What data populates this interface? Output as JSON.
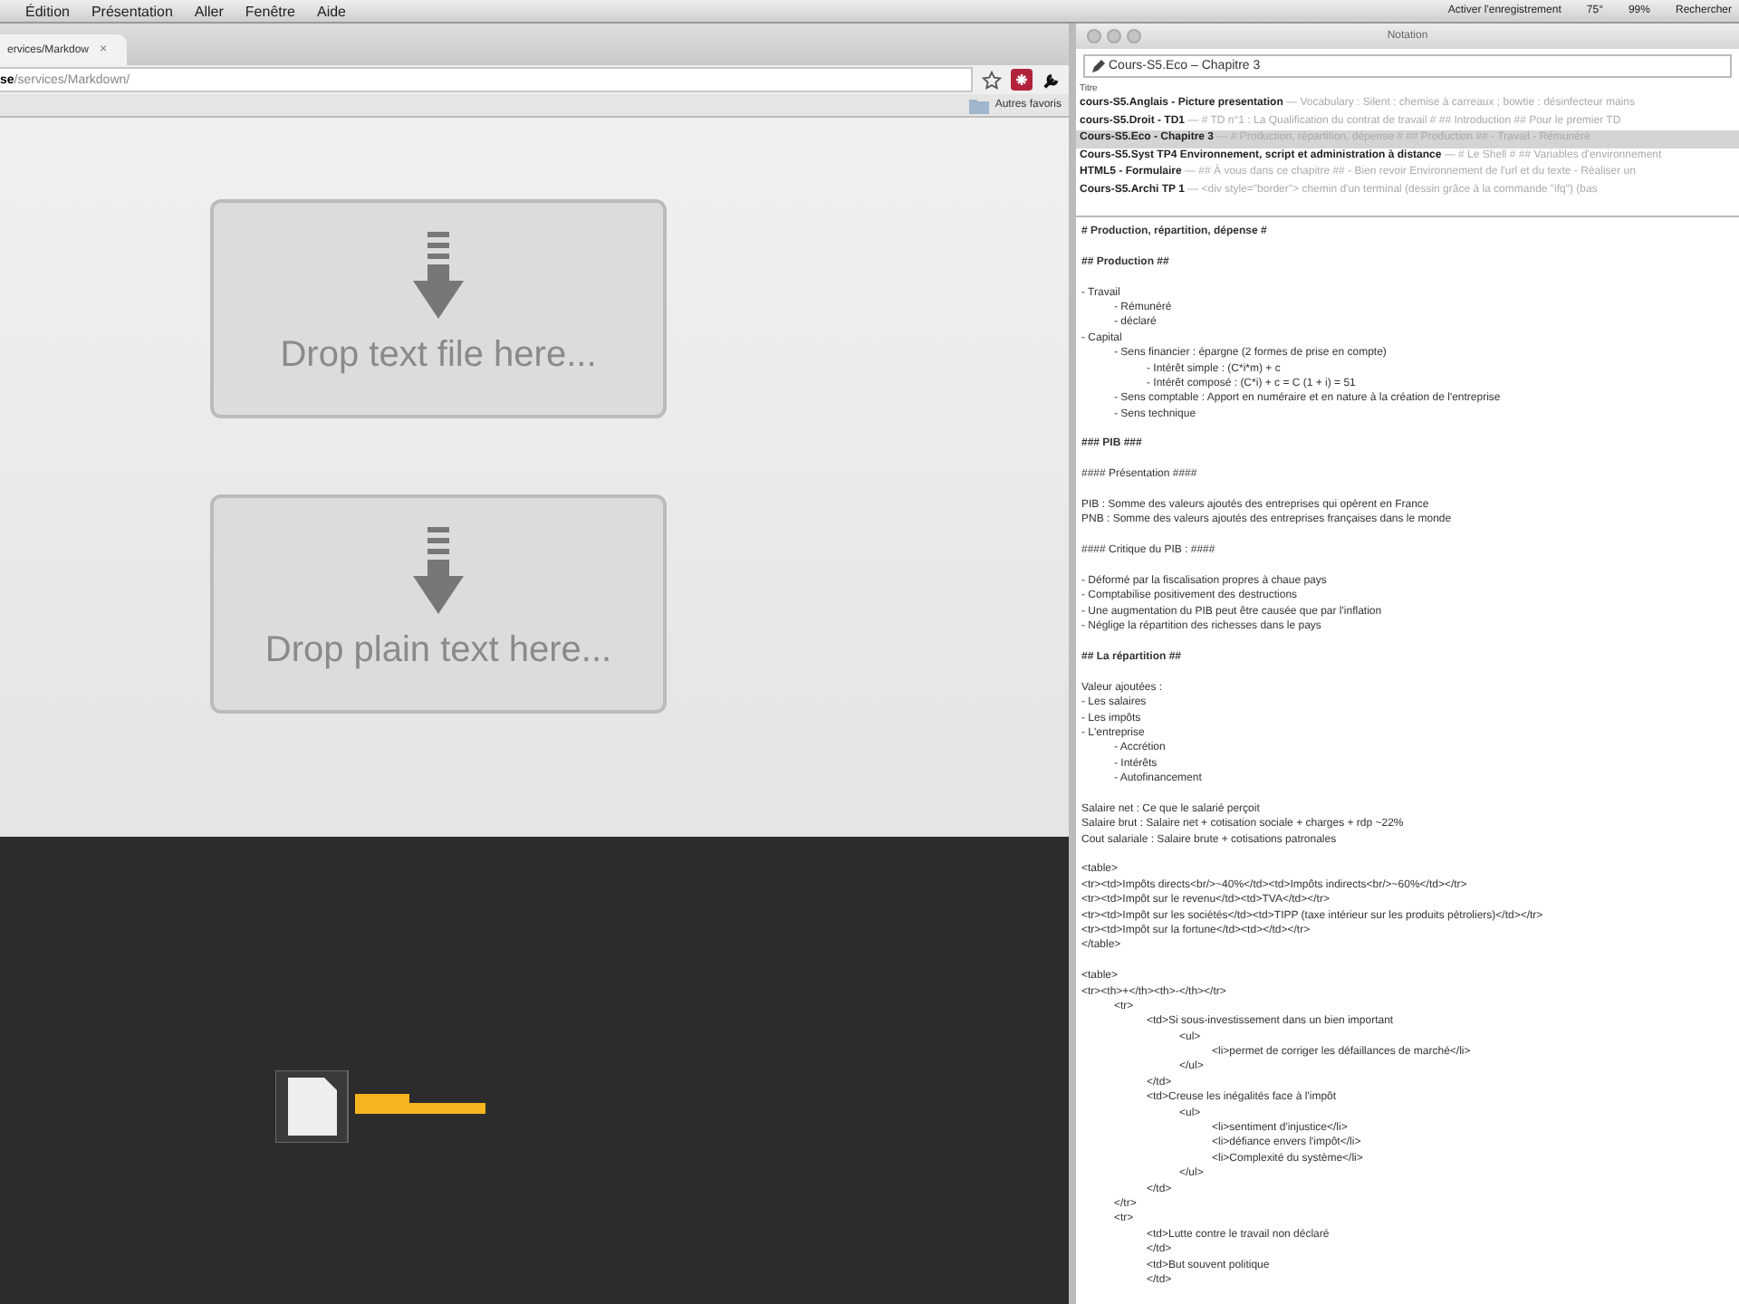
{
  "menu_bar": {
    "items": [
      "Édition",
      "Présentation",
      "Aller",
      "Fenêtre",
      "Aide"
    ],
    "status": [
      "Activer l'enregistrement",
      "75°",
      "99%",
      "Rechercher"
    ]
  },
  "browser": {
    "tab": {
      "label": "ervices/Markdow",
      "close": "×"
    },
    "url": {
      "host": "se",
      "path": "/services/Markdown/"
    },
    "bookmarks": [
      "Autres favoris"
    ],
    "drop_zones": [
      {
        "label": "Drop text file here..."
      },
      {
        "label": "Drop plain text here..."
      }
    ]
  },
  "notation": {
    "title": "Notation",
    "note_title": "Cours-S5.Eco – Chapitre 3",
    "list_header": "Titre",
    "notes": [
      {
        "title": "cours-S5.Anglais - Picture presentation",
        "preview": "— Vocabulary : Silent : chemise à carreaux ; bowtie : désinfecteur mains",
        "selected": false
      },
      {
        "title": "cours-S5.Droit - TD1",
        "preview": "— # TD n°1 : La Qualification du contrat de travail # ## Introduction ## Pour le premier TD",
        "selected": false
      },
      {
        "title": "Cours-S5.Eco - Chapitre 3",
        "preview": "— # Production, répartition, dépense # ## Production ## - Travail - Rémunéré",
        "selected": true
      },
      {
        "title": "Cours-S5.Syst TP4 Environnement, script et administration à distance",
        "preview": "— # Le Shell # ## Variables d'environnement",
        "selected": false
      },
      {
        "title": "HTML5 - Formulaire",
        "preview": "— ## À vous dans ce chapitre ## - Bien revoir Environnement de l'url et du texte - Réaliser un",
        "selected": false
      },
      {
        "title": "Cours-S5.Archi TP 1",
        "preview": "— <div style=\"border\"> chemin d'un terminal (dessin grâce à la commande \"ifq\") (bas",
        "selected": false
      }
    ],
    "lines": [
      {
        "kind": "heading",
        "text": "# Production, répartition, dépense #"
      },
      {
        "kind": "blank"
      },
      {
        "kind": "heading",
        "text": "## Production ##"
      },
      {
        "kind": "blank"
      },
      {
        "kind": "line",
        "text": "- Travail",
        "children": [
          {
            "kind": "line",
            "text": "- Rémunéré"
          },
          {
            "kind": "line",
            "text": "- déclaré"
          }
        ]
      },
      {
        "kind": "line",
        "text": "- Capital",
        "children": [
          {
            "kind": "line",
            "text": "- Sens financier : épargne (2 formes de prise en compte)",
            "children": [
              {
                "kind": "line",
                "text": "- Intérêt simple : (C*i*m) + c"
              },
              {
                "kind": "line",
                "text": "- Intérêt composé : (C*i) + c = C (1 + i) = 51"
              }
            ]
          },
          {
            "kind": "line",
            "text": "- Sens comptable : Apport en numéraire et en nature à la création de l'entreprise"
          },
          {
            "kind": "line",
            "text": "- Sens technique"
          }
        ]
      },
      {
        "kind": "blank"
      },
      {
        "kind": "heading",
        "text": "### PIB ###"
      },
      {
        "kind": "blank"
      },
      {
        "kind": "line",
        "text": "#### Présentation ####"
      },
      {
        "kind": "blank"
      },
      {
        "kind": "line",
        "text": "PIB : Somme des valeurs ajoutés des entreprises qui opèrent en France"
      },
      {
        "kind": "line",
        "text": "PNB : Somme des valeurs ajoutés des entreprises françaises dans le monde"
      },
      {
        "kind": "blank"
      },
      {
        "kind": "line",
        "text": "#### Critique du PIB : ####"
      },
      {
        "kind": "blank"
      },
      {
        "kind": "line",
        "text": "- Déformé par la fiscalisation propres à chaue pays"
      },
      {
        "kind": "line",
        "text": "- Comptabilise positivement des destructions"
      },
      {
        "kind": "line",
        "text": "- Une augmentation du PIB peut être causée que par l'inflation"
      },
      {
        "kind": "line",
        "text": "- Néglige la répartition des richesses dans le pays"
      },
      {
        "kind": "blank"
      },
      {
        "kind": "heading",
        "text": "## La répartition ##"
      },
      {
        "kind": "blank"
      },
      {
        "kind": "line",
        "text": "Valeur ajoutées :"
      },
      {
        "kind": "line",
        "text": "- Les salaires"
      },
      {
        "kind": "line",
        "text": "- Les impôts"
      },
      {
        "kind": "line",
        "text": "- L'entreprise",
        "children": [
          {
            "kind": "line",
            "text": "- Accrétion"
          },
          {
            "kind": "line",
            "text": "- Intérêts"
          },
          {
            "kind": "line",
            "text": "- Autofinancement"
          }
        ]
      },
      {
        "kind": "blank"
      },
      {
        "kind": "line",
        "text": "Salaire net : Ce que le salarié perçoit"
      },
      {
        "kind": "line",
        "text": "Salaire brut : Salaire net + cotisation sociale + charges + rdp ~22%"
      },
      {
        "kind": "line",
        "text": "Cout salariale : Salaire brute + cotisations patronales"
      },
      {
        "kind": "blank"
      },
      {
        "kind": "line",
        "text": "<table>"
      },
      {
        "kind": "line",
        "text": "<tr><td>Impôts directs<br/>~40%</td><td>Impôts indirects<br/>~60%</td></tr>"
      },
      {
        "kind": "line",
        "text": "<tr><td>Impôt sur le revenu</td><td>TVA</td></tr>"
      },
      {
        "kind": "line",
        "text": "<tr><td>Impôt sur les sociétés</td><td>TIPP (taxe intérieur sur les produits pétroliers)</td></tr>"
      },
      {
        "kind": "line",
        "text": "<tr><td>Impôt sur la fortune</td><td></td></tr>"
      },
      {
        "kind": "line",
        "text": "</table>"
      },
      {
        "kind": "blank"
      },
      {
        "kind": "line",
        "text": "<table>"
      },
      {
        "kind": "line",
        "text": "<tr><th>+</th><th>-</th></tr>",
        "children": [
          {
            "kind": "line",
            "text": "<tr>",
            "children": [
              {
                "kind": "line",
                "text": "<td>Si sous-investissement dans un bien important",
                "children": [
                  {
                    "kind": "line",
                    "text": "<ul>",
                    "children": [
                      {
                        "kind": "line",
                        "text": "<li>permet de corriger les défaillances de marché</li>"
                      }
                    ]
                  },
                  {
                    "kind": "line",
                    "text": "</ul>"
                  }
                ]
              },
              {
                "kind": "line",
                "text": "</td>"
              },
              {
                "kind": "line",
                "text": "<td>Creuse les inégalités face à l'impôt",
                "children": [
                  {
                    "kind": "line",
                    "text": "<ul>",
                    "children": [
                      {
                        "kind": "line",
                        "text": "<li>sentiment d'injustice</li>"
                      },
                      {
                        "kind": "line",
                        "text": "<li>défiance envers l'impôt</li>"
                      },
                      {
                        "kind": "line",
                        "text": "<li>Complexité du système</li>"
                      }
                    ]
                  },
                  {
                    "kind": "line",
                    "text": "</ul>"
                  }
                ]
              },
              {
                "kind": "line",
                "text": "</td>"
              }
            ]
          },
          {
            "kind": "line",
            "text": "</tr>"
          },
          {
            "kind": "line",
            "text": "<tr>",
            "children": [
              {
                "kind": "line",
                "text": "<td>Lutte contre le travail non déclaré"
              },
              {
                "kind": "line",
                "text": "</td>"
              },
              {
                "kind": "line",
                "text": "<td>But souvent politique"
              },
              {
                "kind": "line",
                "text": "</td>"
              }
            ]
          }
        ]
      }
    ]
  }
}
